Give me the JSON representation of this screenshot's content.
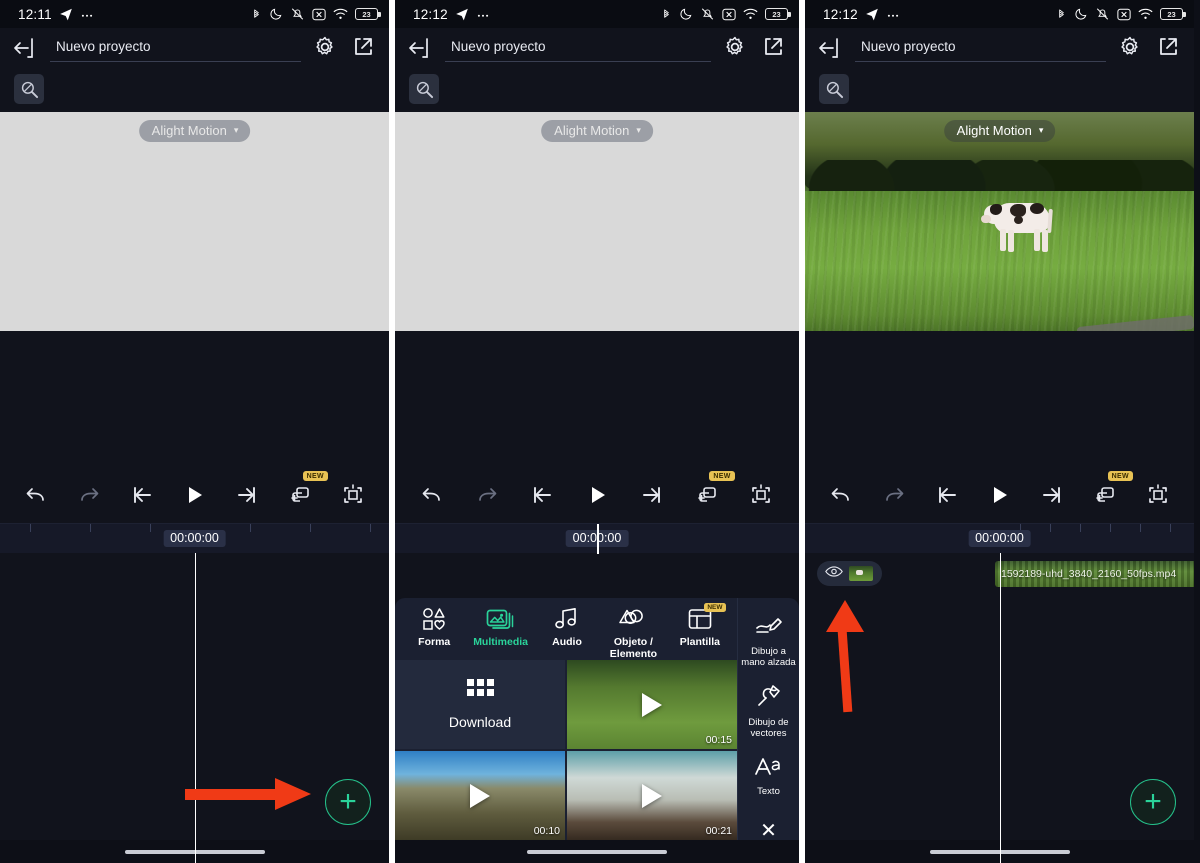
{
  "app": {
    "name": "Alight Motion",
    "watermark_label": "Alight Motion",
    "watermark_caret": "▾",
    "project_title": "Nuevo proyecto"
  },
  "panels": [
    {
      "id": "panel-1",
      "status": {
        "time": "12:11",
        "icons": [
          "telegram-icon",
          "more-icon",
          "bluetooth-icon",
          "dnd-moon-icon",
          "vibrate-off-icon",
          "x-box-icon",
          "wifi-icon"
        ],
        "battery": "23"
      },
      "header": {
        "back_icon": "back-arrow-icon",
        "title": "Nuevo proyecto",
        "settings_icon": "gear-icon",
        "export_icon": "export-icon"
      },
      "tools": {
        "magnifier_icon": "magnifier-icon"
      },
      "preview": {
        "type": "empty",
        "bg": "#d9d9d9"
      },
      "timeline": {
        "time_badge": "00:00:00"
      },
      "fab": {
        "label": "+",
        "color": "#2ad39a"
      },
      "annotation": {
        "arrow": "right-arrow",
        "color": "#f03a16"
      }
    },
    {
      "id": "panel-2",
      "status": {
        "time": "12:12",
        "battery": "23"
      },
      "header": {
        "title": "Nuevo proyecto"
      },
      "timeline": {
        "time_badge": "00:00:00"
      },
      "annotation": {
        "arrow": "down-arrow",
        "color": "#f03a16"
      },
      "sheet": {
        "categories": [
          {
            "label": "Forma",
            "icon": "shapes-icon",
            "active": false,
            "badge": ""
          },
          {
            "label": "Multimedia",
            "icon": "media-stack-icon",
            "active": true,
            "badge": ""
          },
          {
            "label": "Audio",
            "icon": "music-note-icon",
            "active": false,
            "badge": ""
          },
          {
            "label": "Objeto /\nElemento",
            "icon": "objects-icon",
            "active": false,
            "badge": ""
          },
          {
            "label": "Plantilla",
            "icon": "template-icon",
            "active": false,
            "badge": "NEW"
          }
        ],
        "media": [
          {
            "type": "download",
            "label": "Download",
            "icon": "grid-dots-icon"
          },
          {
            "type": "video",
            "thumb": "cow-field",
            "duration": "00:15"
          },
          {
            "type": "video",
            "thumb": "mountain-road",
            "duration": "00:10"
          },
          {
            "type": "video",
            "thumb": "snow-rocks",
            "duration": "00:21"
          }
        ],
        "right_tools": [
          {
            "label": "Dibujo a mano alzada",
            "icon": "freehand-draw-icon"
          },
          {
            "label": "Dibujo de vectores",
            "icon": "vector-pen-icon"
          },
          {
            "label": "Texto",
            "icon": "text-aa-icon"
          }
        ],
        "close_label": "✕"
      }
    },
    {
      "id": "panel-3",
      "status": {
        "time": "12:12",
        "battery": "23"
      },
      "header": {
        "title": "Nuevo proyecto"
      },
      "preview": {
        "type": "cow-field-video"
      },
      "timeline": {
        "time_badge": "00:00:00",
        "layer_visibility_icon": "eye-icon",
        "clip_name": "1592189-uhd_3840_2160_50fps.mp4"
      },
      "fab": {
        "label": "+"
      },
      "annotation": {
        "arrow": "up-arrow",
        "color": "#f03a16"
      }
    }
  ],
  "controls": {
    "undo": "undo-icon",
    "redo": "redo-icon",
    "skip_start": "skip-to-start-icon",
    "play": "play-icon",
    "skip_end": "skip-to-end-icon",
    "add_layer": "add-layer-icon",
    "add_layer_badge": "NEW",
    "fit_frame": "fit-frame-icon"
  },
  "colors": {
    "accent_green": "#2ad39a",
    "annotation_red": "#f03a16",
    "badge_yellow": "#e8c254",
    "panel_bg": "#11131c",
    "sheet_bg": "#1b2031"
  }
}
